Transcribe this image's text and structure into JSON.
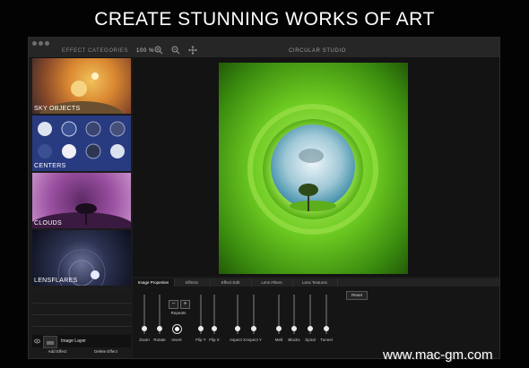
{
  "headline": "CREATE STUNNING WORKS OF ART",
  "window": {
    "title": "CIRCULAR STUDIO",
    "sidebar_header": "EFFECT CATEGORIES",
    "zoom": "100 %"
  },
  "categories": [
    {
      "label": "SKY OBJECTS"
    },
    {
      "label": "CENTERS"
    },
    {
      "label": "CLOUDS"
    },
    {
      "label": "LENSFLARES"
    }
  ],
  "tabs": [
    "Image Properties",
    "Effects",
    "Effect Edit",
    "Lens Filters",
    "Lens Textures"
  ],
  "properties": {
    "zoom": "Zoom",
    "rotate": "Rotate",
    "repeats": "Repeats",
    "invert": "Invert",
    "flip_y": "Flip Y",
    "flip_x": "Flip X",
    "aspect_x": "Aspect X",
    "aspect_y": "Aspect Y",
    "melt": "Melt",
    "blocks": "Blocks",
    "spiral": "Spiral",
    "tunnel": "Tunnel",
    "reset": "Reset",
    "minus": "−",
    "plus": "+"
  },
  "layers": {
    "item": "Image Layer",
    "add": "Add Effect",
    "delete": "Delete Effect"
  },
  "watermark": "www.mac-gm.com"
}
